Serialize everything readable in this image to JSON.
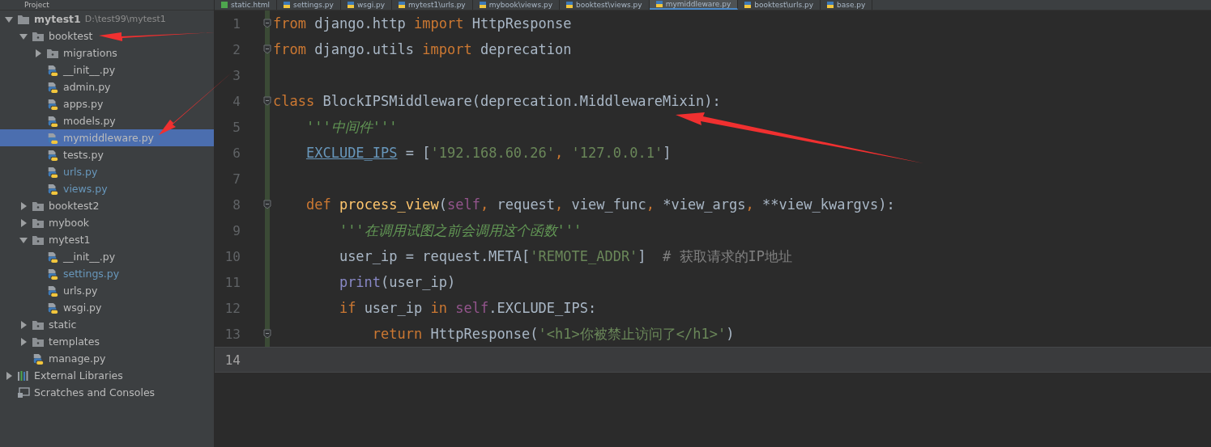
{
  "project_panel": {
    "title": "Project"
  },
  "editor_tabs": [
    {
      "label": "static.html",
      "kind": "html",
      "selected": false
    },
    {
      "label": "settings.py",
      "kind": "python",
      "selected": false
    },
    {
      "label": "wsgi.py",
      "kind": "python",
      "selected": false
    },
    {
      "label": "mytest1\\urls.py",
      "kind": "python",
      "selected": false
    },
    {
      "label": "mybook\\views.py",
      "kind": "python",
      "selected": false
    },
    {
      "label": "booktest\\views.py",
      "kind": "python",
      "selected": false
    },
    {
      "label": "mymiddleware.py",
      "kind": "python",
      "selected": true
    },
    {
      "label": "booktest\\urls.py",
      "kind": "python",
      "selected": false
    },
    {
      "label": "base.py",
      "kind": "python",
      "selected": false
    }
  ],
  "tree": [
    {
      "label": "mytest1",
      "path": "D:\\test99\\mytest1",
      "kind": "root",
      "expanded": true,
      "selected": false,
      "modified": false,
      "children": [
        {
          "label": "booktest",
          "kind": "folder",
          "expanded": true,
          "selected": false,
          "modified": false,
          "children": [
            {
              "label": "migrations",
              "kind": "folder",
              "expanded": false,
              "selected": false,
              "modified": false
            },
            {
              "label": "__init__.py",
              "kind": "python",
              "selected": false,
              "modified": false
            },
            {
              "label": "admin.py",
              "kind": "python",
              "selected": false,
              "modified": false
            },
            {
              "label": "apps.py",
              "kind": "python",
              "selected": false,
              "modified": false
            },
            {
              "label": "models.py",
              "kind": "python",
              "selected": false,
              "modified": false
            },
            {
              "label": "mymiddleware.py",
              "kind": "python",
              "selected": true,
              "modified": false
            },
            {
              "label": "tests.py",
              "kind": "python",
              "selected": false,
              "modified": false
            },
            {
              "label": "urls.py",
              "kind": "python",
              "selected": false,
              "modified": true
            },
            {
              "label": "views.py",
              "kind": "python",
              "selected": false,
              "modified": true
            }
          ]
        },
        {
          "label": "booktest2",
          "kind": "folder",
          "expanded": false,
          "selected": false,
          "modified": false
        },
        {
          "label": "mybook",
          "kind": "folder",
          "expanded": false,
          "selected": false,
          "modified": false
        },
        {
          "label": "mytest1",
          "kind": "folder",
          "expanded": true,
          "selected": false,
          "modified": false,
          "children": [
            {
              "label": "__init__.py",
              "kind": "python",
              "selected": false,
              "modified": false
            },
            {
              "label": "settings.py",
              "kind": "python",
              "selected": false,
              "modified": true
            },
            {
              "label": "urls.py",
              "kind": "python",
              "selected": false,
              "modified": false
            },
            {
              "label": "wsgi.py",
              "kind": "python",
              "selected": false,
              "modified": false
            }
          ]
        },
        {
          "label": "static",
          "kind": "folder",
          "expanded": false,
          "selected": false,
          "modified": false
        },
        {
          "label": "templates",
          "kind": "folder",
          "expanded": false,
          "selected": false,
          "modified": false
        },
        {
          "label": "manage.py",
          "kind": "python",
          "selected": false,
          "modified": false
        }
      ]
    },
    {
      "label": "External Libraries",
      "kind": "libraries",
      "expanded": false,
      "selected": false,
      "modified": false
    },
    {
      "label": "Scratches and Consoles",
      "kind": "scratches",
      "selected": false,
      "modified": false
    }
  ],
  "code_lines": [
    {
      "number": "1",
      "fold": true,
      "current": false,
      "tokens": [
        {
          "kind": "keyword",
          "text": "from"
        },
        {
          "kind": "text",
          "text": " django.http "
        },
        {
          "kind": "keyword",
          "text": "import"
        },
        {
          "kind": "text",
          "text": " HttpResponse"
        }
      ]
    },
    {
      "number": "2",
      "fold": true,
      "current": false,
      "tokens": [
        {
          "kind": "keyword",
          "text": "from"
        },
        {
          "kind": "text",
          "text": " django.utils "
        },
        {
          "kind": "keyword",
          "text": "import"
        },
        {
          "kind": "text",
          "text": " deprecation"
        }
      ]
    },
    {
      "number": "3",
      "fold": false,
      "current": false
    },
    {
      "number": "4",
      "fold": true,
      "current": false,
      "tokens": [
        {
          "kind": "keyword",
          "text": "class"
        },
        {
          "kind": "text",
          "text": " BlockIPSMiddleware(deprecation.MiddlewareMixin):"
        }
      ]
    },
    {
      "number": "5",
      "fold": false,
      "current": false,
      "tokens": [
        {
          "kind": "docstring",
          "text": "    '''中间件'''"
        }
      ]
    },
    {
      "number": "6",
      "fold": false,
      "current": false,
      "tokens": [
        {
          "kind": "field",
          "text": "    EXCLUDE_IPS"
        },
        {
          "kind": "text",
          "text": " = ["
        },
        {
          "kind": "string",
          "text": "'192.168.60.26'"
        },
        {
          "kind": "keyword",
          "text": ", "
        },
        {
          "kind": "string",
          "text": "'127.0.0.1'"
        },
        {
          "kind": "text",
          "text": "]"
        }
      ]
    },
    {
      "number": "7",
      "fold": false,
      "current": false
    },
    {
      "number": "8",
      "fold": true,
      "current": false,
      "tokens": [
        {
          "kind": "keyword",
          "text": "    def"
        },
        {
          "kind": "function",
          "text": " process_view"
        },
        {
          "kind": "text",
          "text": "("
        },
        {
          "kind": "self",
          "text": "self"
        },
        {
          "kind": "keyword",
          "text": ", "
        },
        {
          "kind": "text",
          "text": "request"
        },
        {
          "kind": "keyword",
          "text": ", "
        },
        {
          "kind": "text",
          "text": "view_func"
        },
        {
          "kind": "keyword",
          "text": ", "
        },
        {
          "kind": "text",
          "text": "*view_args"
        },
        {
          "kind": "keyword",
          "text": ", "
        },
        {
          "kind": "text",
          "text": "**view_kwargvs):"
        }
      ]
    },
    {
      "number": "9",
      "fold": false,
      "current": false,
      "tokens": [
        {
          "kind": "docstring",
          "text": "        '''在调用试图之前会调用这个函数'''"
        }
      ]
    },
    {
      "number": "10",
      "fold": false,
      "current": false,
      "tokens": [
        {
          "kind": "text",
          "text": "        user_ip = request.META["
        },
        {
          "kind": "string",
          "text": "'REMOTE_ADDR'"
        },
        {
          "kind": "text",
          "text": "]  "
        },
        {
          "kind": "comment",
          "text": "# 获取请求的IP地址"
        }
      ]
    },
    {
      "number": "11",
      "fold": false,
      "current": false,
      "tokens": [
        {
          "kind": "builtin",
          "text": "        print"
        },
        {
          "kind": "text",
          "text": "(user_ip)"
        }
      ]
    },
    {
      "number": "12",
      "fold": false,
      "current": false,
      "tokens": [
        {
          "kind": "keyword",
          "text": "        if"
        },
        {
          "kind": "text",
          "text": " user_ip "
        },
        {
          "kind": "keyword",
          "text": "in"
        },
        {
          "kind": "self",
          "text": " self"
        },
        {
          "kind": "text",
          "text": ".EXCLUDE_IPS:"
        }
      ]
    },
    {
      "number": "13",
      "fold": true,
      "current": false,
      "tokens": [
        {
          "kind": "keyword",
          "text": "            return"
        },
        {
          "kind": "text",
          "text": " HttpResponse("
        },
        {
          "kind": "string",
          "text": "'<h1>你被禁止访问了</h1>'"
        },
        {
          "kind": "text",
          "text": ")"
        }
      ]
    },
    {
      "number": "14",
      "fold": false,
      "current": true
    }
  ]
}
